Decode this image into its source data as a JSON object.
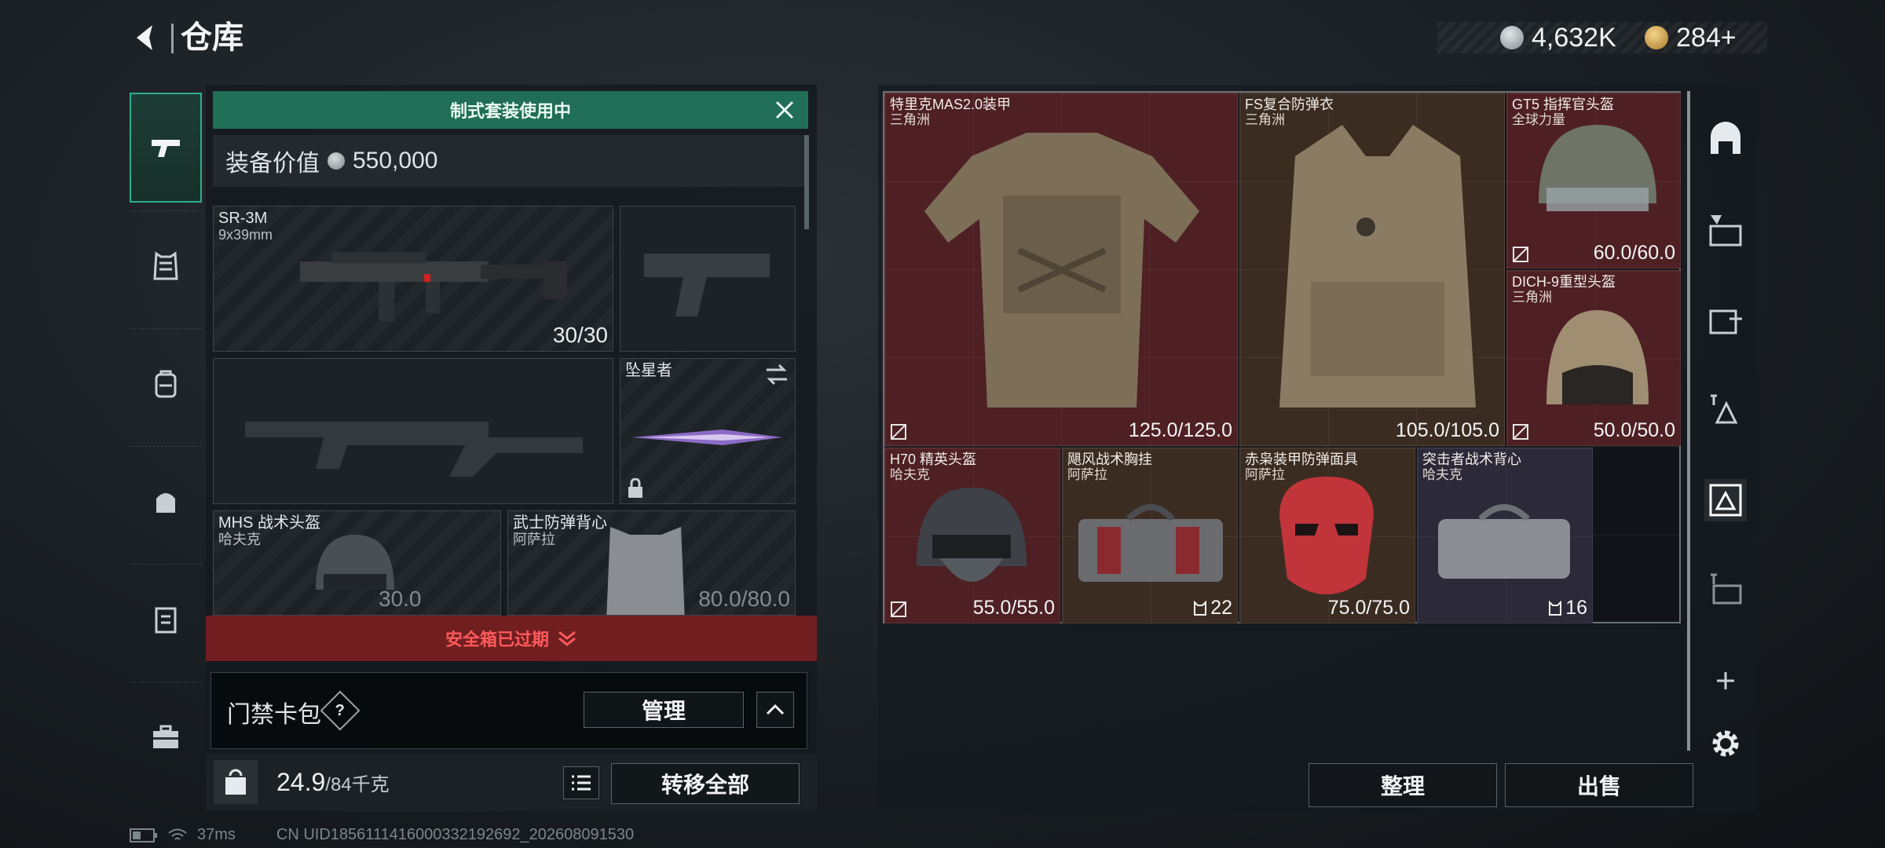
{
  "header": {
    "title": "仓库"
  },
  "currency": {
    "silver": "4,632K",
    "gold": "284+"
  },
  "loadout": {
    "banner": "制式套装使用中",
    "value_label": "装备价值",
    "value": "550,000",
    "slots": {
      "primary": {
        "name": "SR-3M",
        "sub": "9x39mm",
        "durability": "30/30"
      },
      "melee": {
        "name": "坠星者"
      },
      "helmet": {
        "name": "MHS 战术头盔",
        "sub": "哈夫克",
        "durability": "30.0"
      },
      "vest": {
        "name": "武士防弹背心",
        "sub": "阿萨拉",
        "durability": "80.0/80.0"
      }
    },
    "expired": "安全箱已过期",
    "keycard": {
      "label": "门禁卡包",
      "help": "?",
      "manage": "管理"
    },
    "weight": {
      "current": "24.9",
      "max": "/84千克"
    },
    "transfer_all": "转移全部"
  },
  "stash": {
    "items": [
      {
        "name": "特里克MAS2.0装甲",
        "sub": "三角洲",
        "durability": "125.0/125.0",
        "color": "#4e2024"
      },
      {
        "name": "FS复合防弹衣",
        "sub": "三角洲",
        "durability": "105.0/105.0",
        "color": "#3b2c22"
      },
      {
        "name": "GT5 指挥官头盔",
        "sub": "全球力量",
        "durability": "60.0/60.0",
        "color": "#4e2024"
      },
      {
        "name": "DICH-9重型头盔",
        "sub": "三角洲",
        "durability": "50.0/50.0",
        "color": "#4e2024"
      },
      {
        "name": "H70 精英头盔",
        "sub": "哈夫克",
        "durability": "55.0/55.0",
        "color": "#4e2024"
      },
      {
        "name": "飓风战术胸挂",
        "sub": "阿萨拉",
        "capacity": "22",
        "color": "#3b2c22"
      },
      {
        "name": "赤枭装甲防弹面具",
        "sub": "阿萨拉",
        "durability": "75.0/75.0",
        "color": "#3b2c22"
      },
      {
        "name": "突击者战术背心",
        "sub": "哈夫克",
        "capacity": "16",
        "color": "#2c2a38"
      }
    ],
    "sort": "整理",
    "sell": "出售"
  },
  "status": {
    "ping": "37ms",
    "uid": "CN UID1856111416000332192692_202608091530"
  },
  "colors": {
    "accent": "#2fae8c",
    "banner": "#1f6e55",
    "expired": "#ff5a5a"
  }
}
